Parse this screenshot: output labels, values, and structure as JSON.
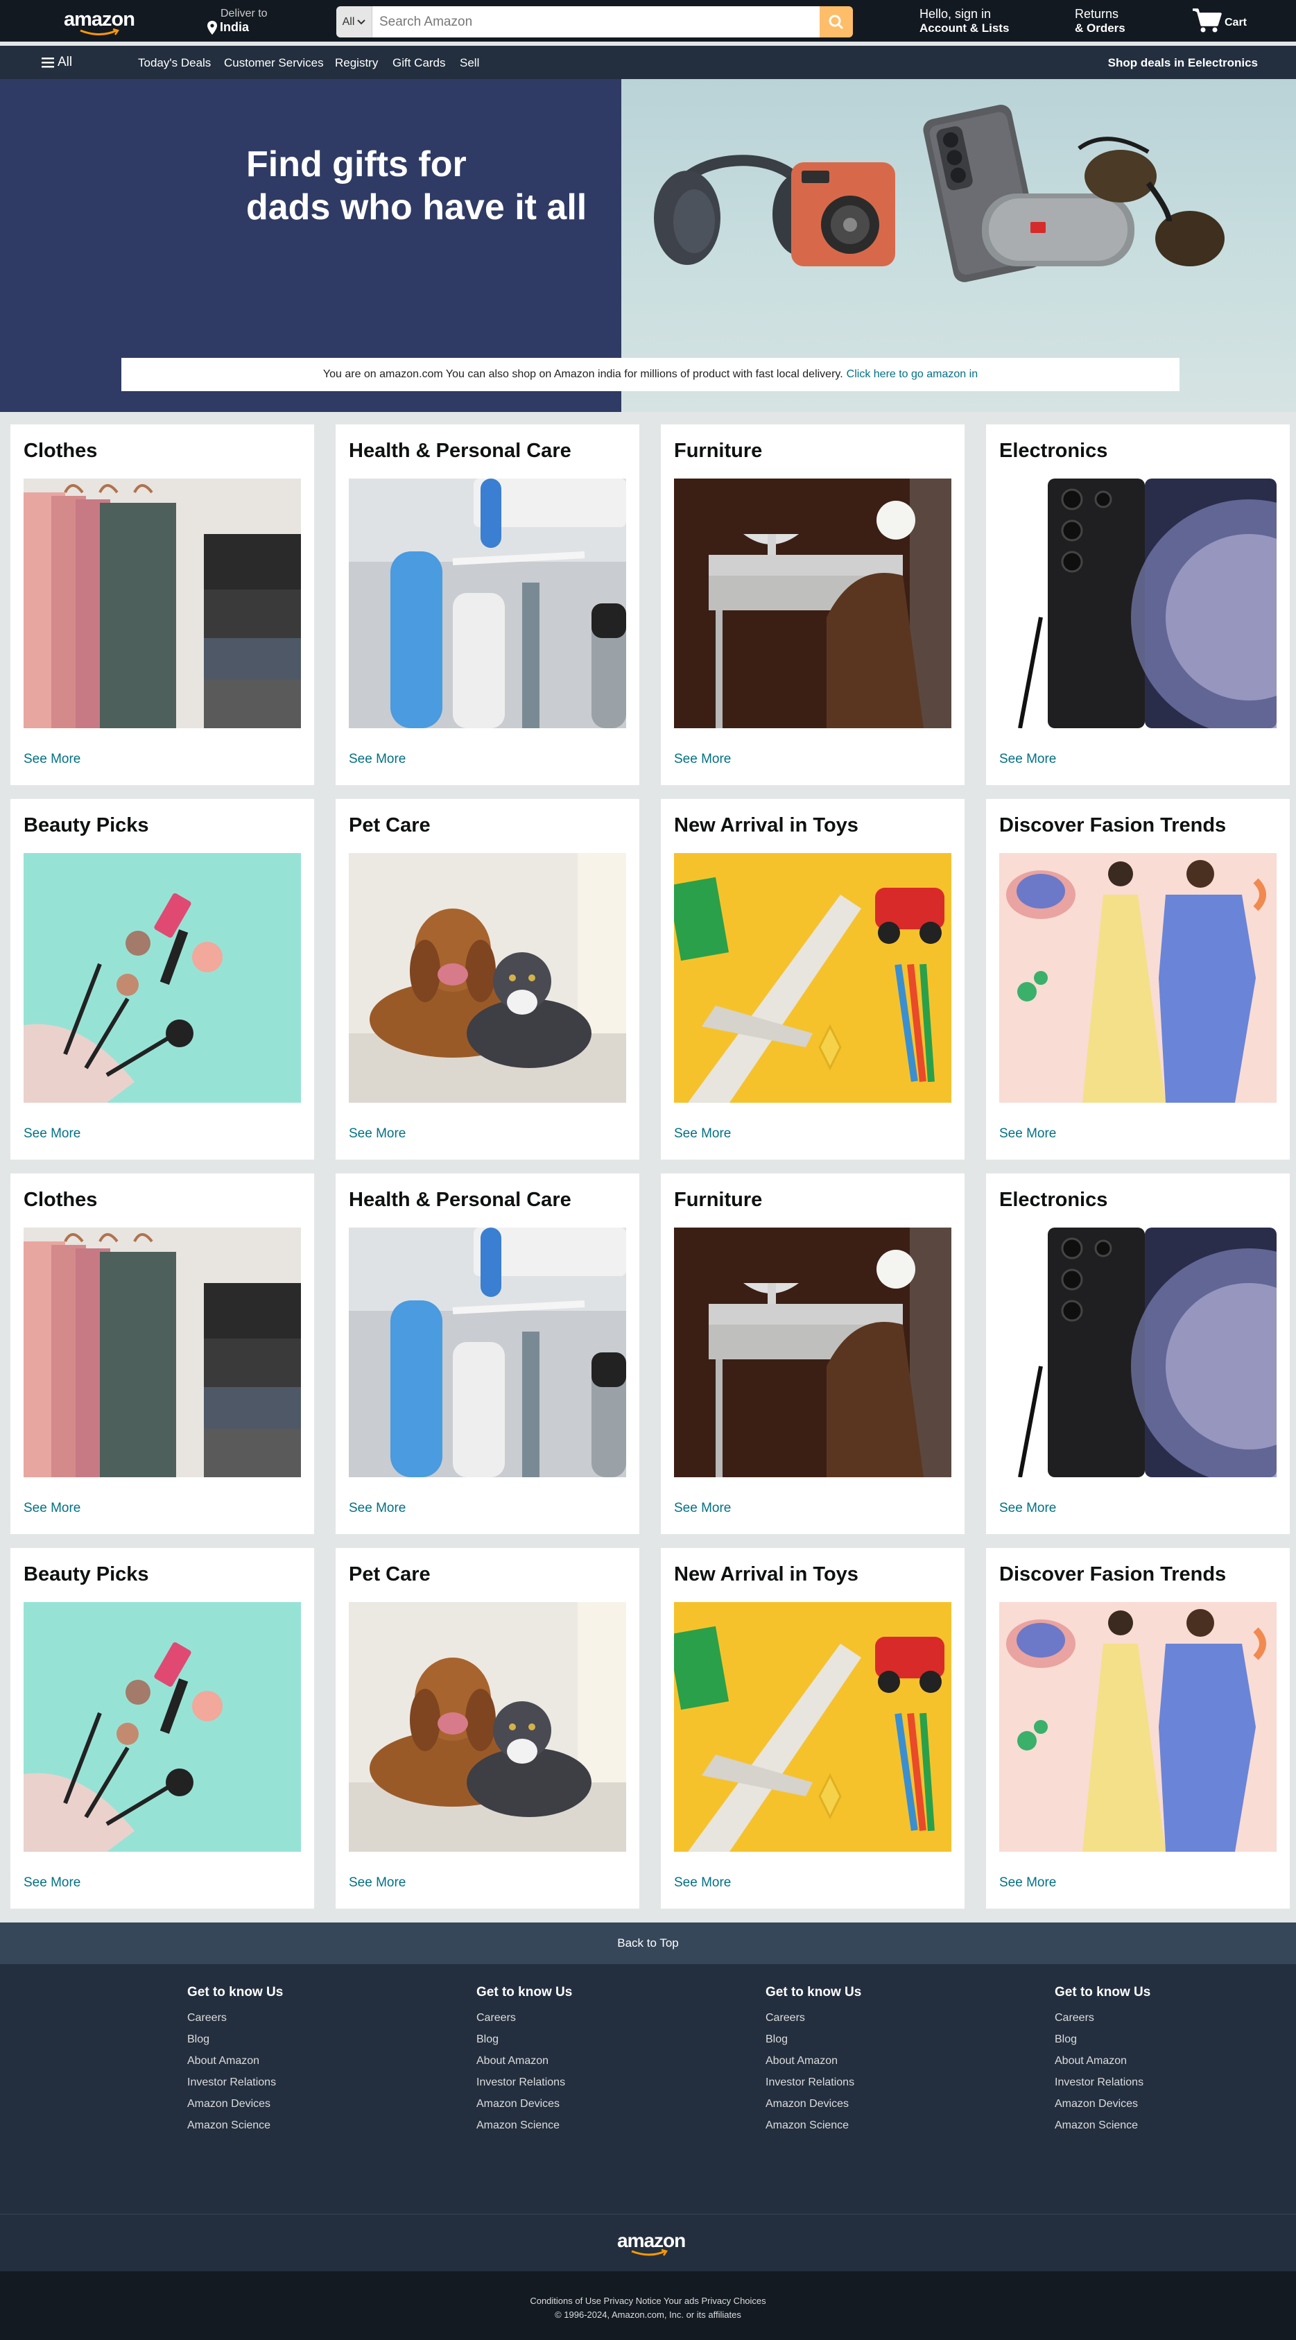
{
  "header": {
    "logo": "amazon",
    "deliver_to_label": "Deliver to",
    "deliver_to_location": "India",
    "search_category": "All",
    "search_placeholder": "Search Amazon",
    "signin_line1": "Hello, sign in",
    "signin_line2": "Account & Lists",
    "returns_line1": "Returns",
    "returns_line2": "& Orders",
    "cart_label": "Cart"
  },
  "subnav": {
    "all_label": "All",
    "items": [
      "Today's Deals",
      "Customer Services",
      "Registry",
      "Gift Cards",
      "Sell"
    ],
    "promo": "Shop deals in Eelectronics"
  },
  "hero": {
    "title_line1": "Find gifts for",
    "title_line2": "dads who have it all"
  },
  "notice": {
    "text": "You are on amazon.com You can also shop on Amazon india for millions of product with fast local delivery.",
    "link": "Click here to go amazon in"
  },
  "cards": [
    {
      "title": "Clothes",
      "link": "See More",
      "image": "clothes-image"
    },
    {
      "title": "Health & Personal Care",
      "link": "See More",
      "image": "health-image"
    },
    {
      "title": "Furniture",
      "link": "See More",
      "image": "furniture-image"
    },
    {
      "title": "Electronics",
      "link": "See More",
      "image": "electronics-image"
    },
    {
      "title": "Beauty Picks",
      "link": "See More",
      "image": "beauty-image"
    },
    {
      "title": "Pet Care",
      "link": "See More",
      "image": "pet-image"
    },
    {
      "title": "New Arrival in Toys",
      "link": "See More",
      "image": "toys-image"
    },
    {
      "title": "Discover Fasion Trends",
      "link": "See More",
      "image": "fashion-image"
    },
    {
      "title": "Clothes",
      "link": "See More",
      "image": "clothes-image"
    },
    {
      "title": "Health & Personal Care",
      "link": "See More",
      "image": "health-image"
    },
    {
      "title": "Furniture",
      "link": "See More",
      "image": "furniture-image"
    },
    {
      "title": "Electronics",
      "link": "See More",
      "image": "electronics-image"
    },
    {
      "title": "Beauty Picks",
      "link": "See More",
      "image": "beauty-image"
    },
    {
      "title": "Pet Care",
      "link": "See More",
      "image": "pet-image"
    },
    {
      "title": "New Arrival in Toys",
      "link": "See More",
      "image": "toys-image"
    },
    {
      "title": "Discover Fasion Trends",
      "link": "See More",
      "image": "fashion-image"
    }
  ],
  "footer": {
    "back_to_top": "Back to Top",
    "columns": [
      {
        "heading": "Get to know Us",
        "links": [
          "Careers",
          "Blog",
          "About Amazon",
          "Investor Relations",
          "Amazon Devices",
          "Amazon Science"
        ]
      },
      {
        "heading": "Get to know Us",
        "links": [
          "Careers",
          "Blog",
          "About Amazon",
          "Investor Relations",
          "Amazon Devices",
          "Amazon Science"
        ]
      },
      {
        "heading": "Get to know Us",
        "links": [
          "Careers",
          "Blog",
          "About Amazon",
          "Investor Relations",
          "Amazon Devices",
          "Amazon Science"
        ]
      },
      {
        "heading": "Get to know Us",
        "links": [
          "Careers",
          "Blog",
          "About Amazon",
          "Investor Relations",
          "Amazon Devices",
          "Amazon Science"
        ]
      }
    ],
    "logo": "amazon",
    "legal_links": "Conditions of Use Privacy Notice Your ads Privacy Choices",
    "copyright": "© 1996-2024, Amazon.com, Inc. or its affiliates"
  },
  "colors": {
    "nav_dark": "#131921",
    "nav_secondary": "#232f3e",
    "accent_orange": "#febd69",
    "link_teal": "#007185",
    "hero_navy": "#2f3b64"
  }
}
